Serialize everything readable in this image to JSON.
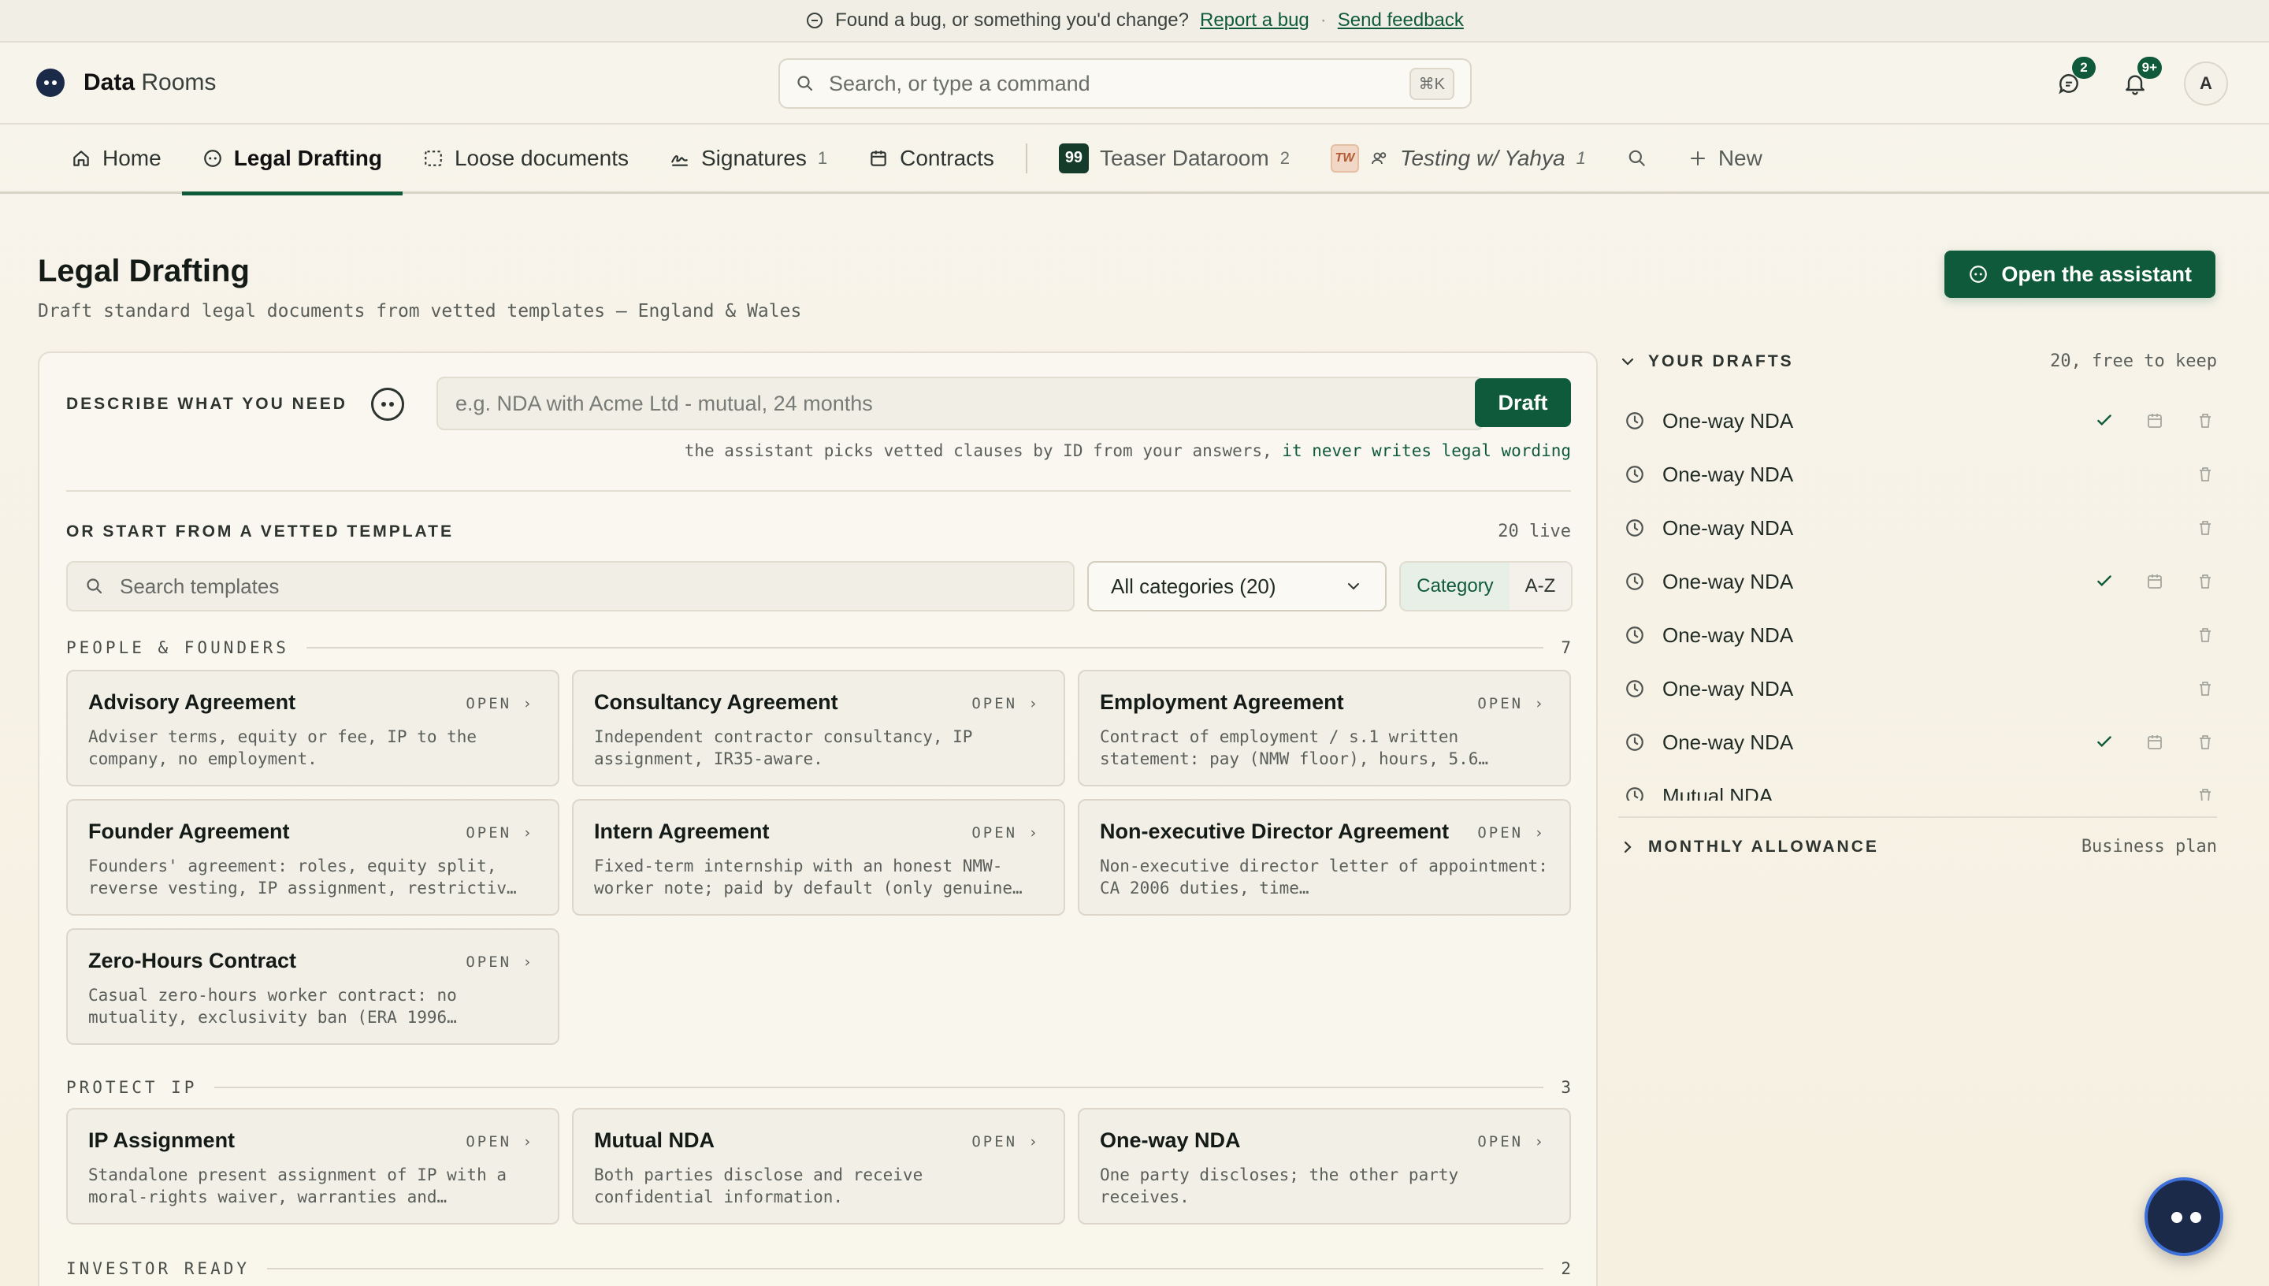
{
  "banner": {
    "message": "Found a bug, or something you'd change?",
    "report_link": "Report a bug",
    "separator": "·",
    "feedback_link": "Send feedback"
  },
  "header": {
    "app_title_bold": "Data",
    "app_title_rest": "Rooms",
    "search_placeholder": "Search, or type a command",
    "search_shortcut": "⌘K",
    "messages_badge": "2",
    "notifications_badge": "9+",
    "avatar_initial": "A"
  },
  "tabs": [
    {
      "label": "Home",
      "icon": "home-icon"
    },
    {
      "label": "Legal Drafting",
      "icon": "bot-icon",
      "active": true
    },
    {
      "label": "Loose documents",
      "icon": "dashed-box-icon"
    },
    {
      "label": "Signatures",
      "icon": "signature-icon",
      "count": "1"
    },
    {
      "label": "Contracts",
      "icon": "calendar-icon"
    },
    {
      "label": "Teaser Dataroom",
      "badge": "99",
      "count": "2"
    },
    {
      "label": "Testing w/ Yahya",
      "badge": "TW",
      "count": "1"
    },
    {
      "label": "New",
      "icon": "plus-icon"
    }
  ],
  "page": {
    "title": "Legal Drafting",
    "subtitle": "Draft standard legal documents from vetted templates — England & Wales",
    "assistant_button": "Open the assistant"
  },
  "describe": {
    "label": "DESCRIBE WHAT YOU NEED",
    "placeholder": "e.g. NDA with Acme Ltd - mutual, 24 months",
    "draft_button": "Draft",
    "hint_prefix": "the assistant picks vetted clauses by ID from your answers,",
    "hint_emphasis": "it never writes legal wording"
  },
  "templates": {
    "label": "OR START FROM A VETTED TEMPLATE",
    "live_count": "20 live",
    "search_placeholder": "Search templates",
    "category_select": "All categories (20)",
    "sort_category": "Category",
    "sort_az": "A-Z",
    "open_label": "OPEN ›",
    "sections": [
      {
        "title": "PEOPLE & FOUNDERS",
        "count": "7",
        "items": [
          {
            "name": "Advisory Agreement",
            "desc": "Adviser terms, equity or fee, IP to the company, no employment."
          },
          {
            "name": "Consultancy Agreement",
            "desc": "Independent contractor consultancy, IP assignment, IR35-aware."
          },
          {
            "name": "Employment Agreement",
            "desc": "Contract of employment / s.1 written statement: pay (NMW floor), hours, 5.6…"
          },
          {
            "name": "Founder Agreement",
            "desc": "Founders' agreement: roles, equity split, reverse vesting, IP assignment, restrictiv…"
          },
          {
            "name": "Intern Agreement",
            "desc": "Fixed-term internship with an honest NMW-worker note; paid by default (only genuine…"
          },
          {
            "name": "Non-executive Director Agreement",
            "desc": "Non-executive director letter of appointment: CA 2006 duties, time…"
          },
          {
            "name": "Zero-Hours Contract",
            "desc": "Casual zero-hours worker contract: no mutuality, exclusivity ban (ERA 1996…"
          }
        ]
      },
      {
        "title": "PROTECT IP",
        "count": "3",
        "items": [
          {
            "name": "IP Assignment",
            "desc": "Standalone present assignment of IP with a moral-rights waiver, warranties and…"
          },
          {
            "name": "Mutual NDA",
            "desc": "Both parties disclose and receive confidential information."
          },
          {
            "name": "One-way NDA",
            "desc": "One party discloses; the other party receives."
          }
        ]
      },
      {
        "title": "INVESTOR READY",
        "count": "2",
        "items": []
      }
    ]
  },
  "drafts": {
    "label": "YOUR DRAFTS",
    "count_text": "20, free to keep",
    "items": [
      {
        "name": "One-way NDA",
        "checked": true,
        "calendar": true
      },
      {
        "name": "One-way NDA",
        "checked": false,
        "calendar": false
      },
      {
        "name": "One-way NDA",
        "checked": false,
        "calendar": false
      },
      {
        "name": "One-way NDA",
        "checked": true,
        "calendar": true
      },
      {
        "name": "One-way NDA",
        "checked": false,
        "calendar": false
      },
      {
        "name": "One-way NDA",
        "checked": false,
        "calendar": false
      },
      {
        "name": "One-way NDA",
        "checked": true,
        "calendar": true
      },
      {
        "name": "Mutual NDA",
        "checked": false,
        "calendar": false
      }
    ]
  },
  "allowance": {
    "label": "MONTHLY ALLOWANCE",
    "plan": "Business plan"
  },
  "colors": {
    "accent": "#0f5a3a",
    "background": "#f6f2e8"
  }
}
